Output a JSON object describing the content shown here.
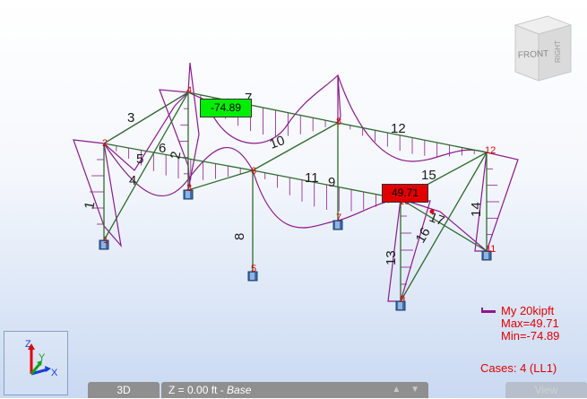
{
  "moment_boxes": {
    "min_value": "-74.89",
    "max_value": "49.71",
    "min_color": "#00ee00",
    "max_color": "#e00000"
  },
  "members": [
    {
      "id": "m1",
      "label": "1"
    },
    {
      "id": "m2",
      "label": "2"
    },
    {
      "id": "m3",
      "label": "3"
    },
    {
      "id": "m4",
      "label": "4"
    },
    {
      "id": "m5",
      "label": "5"
    },
    {
      "id": "m6",
      "label": "6"
    },
    {
      "id": "m7",
      "label": "7"
    },
    {
      "id": "m8",
      "label": "8"
    },
    {
      "id": "m9",
      "label": "9"
    },
    {
      "id": "m10",
      "label": "10"
    },
    {
      "id": "m11",
      "label": "11"
    },
    {
      "id": "m12",
      "label": "12"
    },
    {
      "id": "m13",
      "label": "13"
    },
    {
      "id": "m14",
      "label": "14"
    },
    {
      "id": "m15",
      "label": "15"
    },
    {
      "id": "m16",
      "label": "16"
    },
    {
      "id": "m17",
      "label": "17"
    }
  ],
  "nodes": [
    {
      "id": "n1",
      "label": "1"
    },
    {
      "id": "n2",
      "label": "2"
    },
    {
      "id": "n3",
      "label": "3"
    },
    {
      "id": "n4",
      "label": "4"
    },
    {
      "id": "n5",
      "label": "5"
    },
    {
      "id": "n6",
      "label": "6"
    },
    {
      "id": "n7",
      "label": "7"
    },
    {
      "id": "n8",
      "label": "8"
    },
    {
      "id": "n9",
      "label": "9"
    },
    {
      "id": "n10",
      "label": "10"
    },
    {
      "id": "n11",
      "label": "11"
    },
    {
      "id": "n12",
      "label": "12"
    }
  ],
  "view_cube": {
    "front_label": "FRONT",
    "right_label": "RIGHT"
  },
  "legend": {
    "line1": "My  20kipft",
    "max": "Max=49.71",
    "min": "Min=-74.89",
    "cases": "Cases: 4 (LL1)",
    "diagram_color": "#8b1a8b"
  },
  "axis_triad": {
    "z": "Z",
    "y": "Y",
    "x": "X"
  },
  "status_bar": {
    "mode": "3D",
    "z_prefix": "Z = 0.00 ft - ",
    "z_name": "Base",
    "nav_arrows": "▲ ▼",
    "view": "View"
  }
}
